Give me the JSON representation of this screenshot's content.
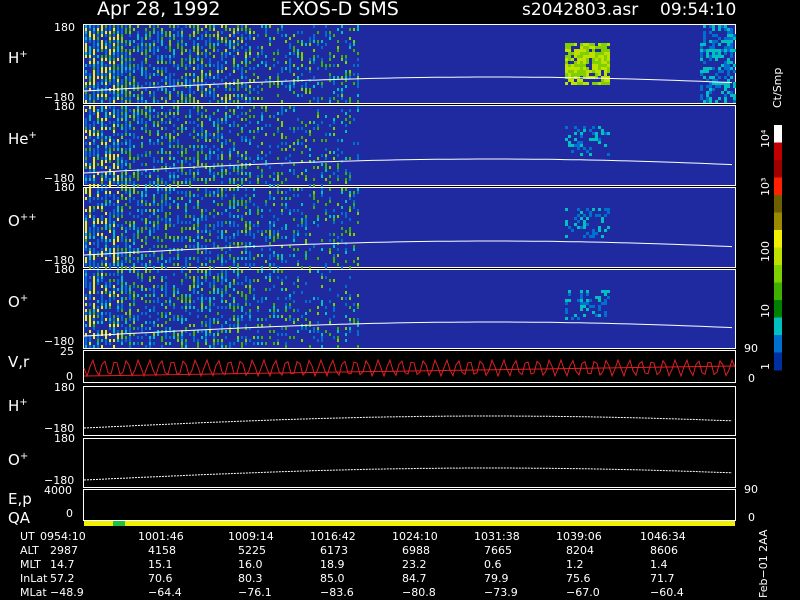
{
  "header": {
    "date": "Apr 28, 1992",
    "instrument": "EXOS-D SMS",
    "file": "s2042803.asr",
    "time": "09:54:10"
  },
  "panels": [
    {
      "label_main": "H",
      "label_sup": "+",
      "ymax": "180",
      "ymin": "−180"
    },
    {
      "label_main": "He",
      "label_sup": "+",
      "ymax": "180",
      "ymin": "−180"
    },
    {
      "label_main": "O",
      "label_sup": "++",
      "ymax": "180",
      "ymin": "−180"
    },
    {
      "label_main": "O",
      "label_sup": "+",
      "ymax": "180",
      "ymin": "−180"
    }
  ],
  "vr_panel": {
    "label": "V,r",
    "ytop": "25",
    "yzero": "0",
    "right_top": "90",
    "right_bottom": "0"
  },
  "line_panels": [
    {
      "label_main": "H",
      "label_sup": "+",
      "ymax": "180",
      "ymin": "−180"
    },
    {
      "label_main": "O",
      "label_sup": "+",
      "ymax": "180",
      "ymin": "−180"
    }
  ],
  "ep_panel": {
    "label_top": "E,p",
    "label_bottom": "QA",
    "ytop": "4000",
    "yzero": "0",
    "right_top": "90",
    "right_bottom": "0"
  },
  "colorbar": {
    "unit": "Ct/Smp",
    "ticks": [
      "10⁴",
      "10³",
      "100",
      "10",
      "1"
    ],
    "colors": [
      "#ffffff",
      "#c00000",
      "#a00000",
      "#ff2000",
      "#6b5f00",
      "#9a8a00",
      "#f0f000",
      "#c0e000",
      "#80d000",
      "#40b000",
      "#008000",
      "#00c0c0",
      "#0070d0",
      "#0030a0"
    ]
  },
  "footer_rows": [
    {
      "label": "UT",
      "values": [
        "0954:10",
        "1001:46",
        "1009:14",
        "1016:42",
        "1024:10",
        "1031:38",
        "1039:06",
        "1046:34"
      ]
    },
    {
      "label": "ALT",
      "values": [
        "2987",
        "4158",
        "5225",
        "6173",
        "6988",
        "7665",
        "8204",
        "8606"
      ]
    },
    {
      "label": "MLT",
      "values": [
        "14.7",
        "15.1",
        "16.0",
        "18.9",
        "23.2",
        "0.6",
        "1.2",
        "1.4"
      ]
    },
    {
      "label": "InLat",
      "values": [
        "57.2",
        "70.6",
        "80.3",
        "85.0",
        "84.7",
        "79.9",
        "75.6",
        "71.7"
      ]
    },
    {
      "label": "MLat",
      "values": [
        "−48.9",
        "−64.4",
        "−76.1",
        "−83.6",
        "−80.8",
        "−73.9",
        "−67.0",
        "−60.4"
      ]
    }
  ],
  "side_note": "Feb−01 2AA",
  "chart_data": {
    "type": "heatmap",
    "title": "Apr 28, 1992 EXOS-D SMS",
    "panels": [
      "H+",
      "He+",
      "O++",
      "O+",
      "V,r",
      "H+",
      "O+",
      "E,p / QA"
    ],
    "x_ticks_ut": [
      "0954:10",
      "1001:46",
      "1009:14",
      "1016:42",
      "1024:10",
      "1031:38",
      "1039:06",
      "1046:34"
    ],
    "pitch_angle_range": [
      -180,
      180
    ],
    "colorbar_range_ct_per_smp": [
      1,
      10000
    ],
    "colorbar_scale": "log",
    "quality_bar": {
      "color": "#f0f000",
      "highlight": "#20c040"
    }
  }
}
